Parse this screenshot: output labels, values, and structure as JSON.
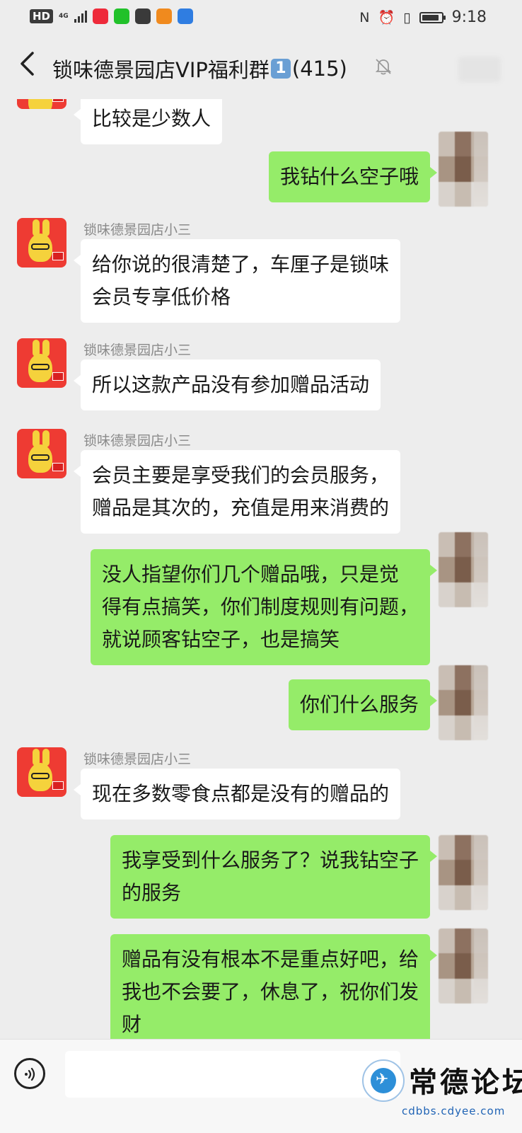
{
  "status_bar": {
    "hd": "HD",
    "network": "4G",
    "app_icons": [
      {
        "name": "xiaohongshu",
        "color": "#ee2a3a",
        "label": "小红书"
      },
      {
        "name": "iqiyi",
        "color": "#21c12a",
        "label": "iQIY"
      },
      {
        "name": "chat",
        "color": "#3a3a3a",
        "label": ""
      },
      {
        "name": "uc",
        "color": "#f08a1e",
        "label": ""
      },
      {
        "name": "circle-app",
        "color": "#2f7de1",
        "label": ""
      }
    ],
    "battery_level": 0.9,
    "time": "9:18"
  },
  "header": {
    "title_prefix": "锁味德景园店VIP福利群",
    "title_badge": "1",
    "title_count": "(415)"
  },
  "colors": {
    "background": "#ededed",
    "incoming_bubble": "#ffffff",
    "outgoing_bubble": "#95ec69",
    "nickname": "#8a8a8a",
    "avatar_red": "#ee3b33"
  },
  "messages": [
    {
      "side": "in",
      "sender": "",
      "lines": [
        "比较是少数人"
      ]
    },
    {
      "side": "out",
      "lines": [
        "我钻什么空子哦"
      ]
    },
    {
      "side": "in",
      "sender": "锁味德景园店小三",
      "lines": [
        "给你说的很清楚了，车厘子是锁味",
        "会员专享低价格"
      ]
    },
    {
      "side": "in",
      "sender": "锁味德景园店小三",
      "lines": [
        "所以这款产品没有参加赠品活动"
      ]
    },
    {
      "side": "in",
      "sender": "锁味德景园店小三",
      "lines": [
        "会员主要是享受我们的会员服务，",
        "赠品是其次的，充值是用来消费的"
      ]
    },
    {
      "side": "out",
      "lines": [
        "没人指望你们几个赠品哦，只是觉",
        "得有点搞笑，你们制度规则有问题，",
        "就说顾客钻空子，也是搞笑"
      ]
    },
    {
      "side": "out",
      "lines": [
        "你们什么服务"
      ]
    },
    {
      "side": "in",
      "sender": "锁味德景园店小三",
      "lines": [
        "现在多数零食点都是没有的赠品的"
      ]
    },
    {
      "side": "out",
      "lines": [
        "我享受到什么服务了？说我钻空子",
        "的服务"
      ]
    },
    {
      "side": "out",
      "lines": [
        "赠品有没有根本不是重点好吧，给",
        "我也不会要了，休息了，祝你们发",
        "财"
      ]
    }
  ],
  "input_bar": {
    "voice_icon": "voice-icon",
    "input_value": ""
  },
  "watermark": {
    "title": "常德论坛",
    "url": "cdbbs.cdyee.com"
  }
}
